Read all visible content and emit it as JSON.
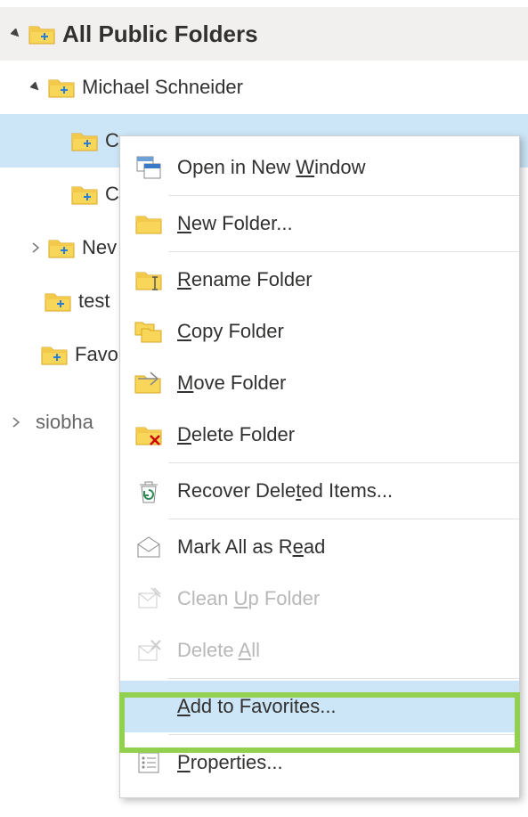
{
  "tree": {
    "root_label": "All Public Folders",
    "user_folder": "Michael Schneider",
    "selected_folder": "Co",
    "folder_2": "Co",
    "folder_3": "Nev",
    "folder_4": "test",
    "favorites_folder": "Favo",
    "account": "siobha"
  },
  "context_menu": {
    "open_new_window": {
      "pre": "Open in New ",
      "u": "W",
      "post": "indow"
    },
    "new_folder": {
      "pre": "",
      "u": "N",
      "post": "ew Folder..."
    },
    "rename_folder": {
      "pre": "",
      "u": "R",
      "post": "ename Folder"
    },
    "copy_folder": {
      "pre": "",
      "u": "C",
      "post": "opy Folder"
    },
    "move_folder": {
      "pre": "",
      "u": "M",
      "post": "ove Folder"
    },
    "delete_folder": {
      "pre": "",
      "u": "D",
      "post": "elete Folder"
    },
    "recover_deleted": {
      "pre": "Recover Dele",
      "u": "t",
      "post": "ed Items..."
    },
    "mark_all_read": {
      "pre": "Mark All as R",
      "u": "e",
      "post": "ad"
    },
    "clean_up": {
      "pre": "Clean ",
      "u": "U",
      "post": "p Folder"
    },
    "delete_all": {
      "pre": "Delete ",
      "u": "A",
      "post": "ll"
    },
    "add_favorites": {
      "pre": "",
      "u": "A",
      "post": "dd to Favorites..."
    },
    "properties": {
      "pre": "",
      "u": "P",
      "post": "roperties..."
    }
  }
}
